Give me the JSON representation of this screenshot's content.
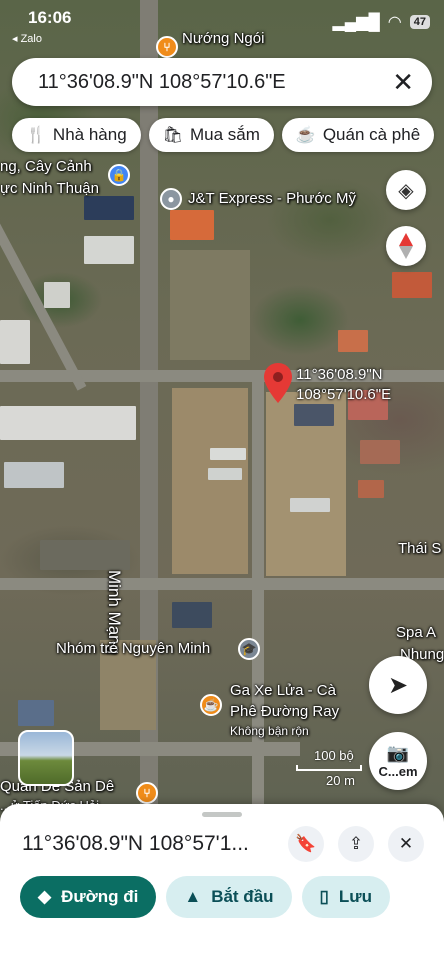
{
  "status_bar": {
    "time": "16:06",
    "back_label": "◂ Zalo",
    "battery": "47"
  },
  "search": {
    "query": "11°36'08.9\"N 108°57'10.6\"E",
    "close_icon": "close-icon"
  },
  "chips": [
    {
      "icon": "restaurant-icon",
      "label": "Nhà hàng"
    },
    {
      "icon": "shopping-icon",
      "label": "Mua sắm"
    },
    {
      "icon": "cafe-icon",
      "label": "Quán cà phê"
    }
  ],
  "map_labels": {
    "top_poi": "Nướng Ngói",
    "shop_line1": "ng, Cây Cảnh",
    "shop_line2": "ực Ninh Thuận",
    "jt": "J&T Express - Phước Mỹ",
    "street": "Minh Mạng",
    "pin_line1": "11°36'08.9\"N",
    "pin_line2": "108°57'10.6\"E",
    "thai": "Thái S",
    "spa1": "Spa A",
    "spa2": "Nhung",
    "kindergarten": "Nhóm trẻ Nguyên Minh",
    "cafe_line1": "Ga Xe Lửa - Cà",
    "cafe_line2": "Phê Đường Ray",
    "cafe_busy": "Không bận rộn",
    "bottom1": "Quán Dê Sản Dê",
    "bottom2": "...ử Tiến Đức Hải"
  },
  "scale": {
    "feet": "100 bộ",
    "meters": "20 m"
  },
  "camera_label": "C...em",
  "sheet": {
    "title": "11°36'08.9\"N 108°57'1...",
    "actions": [
      {
        "icon": "directions-icon",
        "label": "Đường đi"
      },
      {
        "icon": "navigation-arrow-icon",
        "label": "Bắt đầu"
      },
      {
        "icon": "bookmark-icon",
        "label": "Lưu"
      }
    ]
  },
  "colors": {
    "primary": "#0b6e63",
    "secondary_bg": "#d7eef0",
    "pin": "#e53935"
  }
}
